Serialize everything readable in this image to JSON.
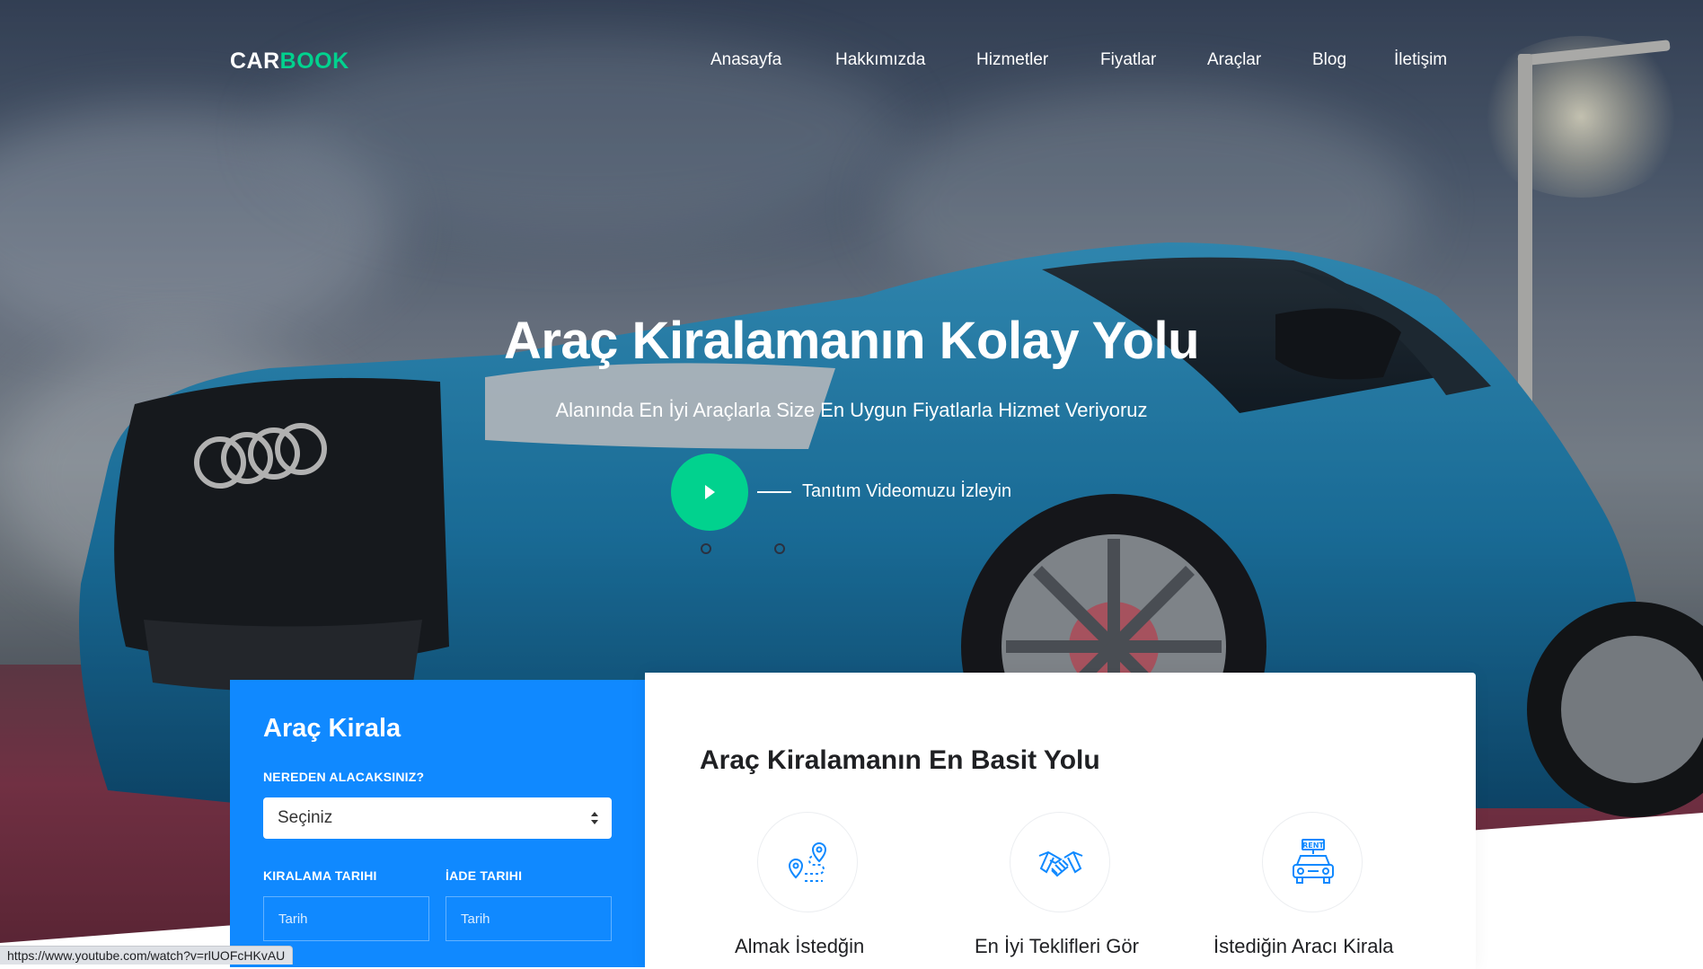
{
  "brand": {
    "part1": "CAR",
    "part2": "BOOK"
  },
  "nav": {
    "items": [
      "Anasayfa",
      "Hakkımızda",
      "Hizmetler",
      "Fiyatlar",
      "Araçlar",
      "Blog",
      "İletişim"
    ]
  },
  "hero": {
    "title": "Araç Kiralamanın Kolay Yolu",
    "subtitle": "Alanında En İyi Araçlarla Size En Uygun Fiyatlarla Hizmet Veriyoruz",
    "video_link": "Tanıtım Videomuzu İzleyin"
  },
  "booking": {
    "title": "Araç Kirala",
    "pickup_label": "NEREDEN ALACAKSINIZ?",
    "pickup_value": "Seçiniz",
    "rent_date_label": "KIRALAMA TARIHI",
    "return_date_label": "İADE TARIHI",
    "rent_date_placeholder": "Tarih",
    "return_date_placeholder": "Tarih"
  },
  "info": {
    "title": "Araç Kiralamanın En Basit Yolu",
    "steps": [
      {
        "icon": "route-map-icon",
        "label": "Almak İstedğin"
      },
      {
        "icon": "handshake-icon",
        "label": "En İyi Teklifleri Gör"
      },
      {
        "icon": "rent-car-icon",
        "label": "İstediğin Aracı Kirala"
      }
    ]
  },
  "status_bar": {
    "url": "https://www.youtube.com/watch?v=rlUOFcHKvAU"
  },
  "colors": {
    "accent_green": "#01d28e",
    "accent_blue": "#1089ff",
    "text_dark": "#1f2023"
  }
}
